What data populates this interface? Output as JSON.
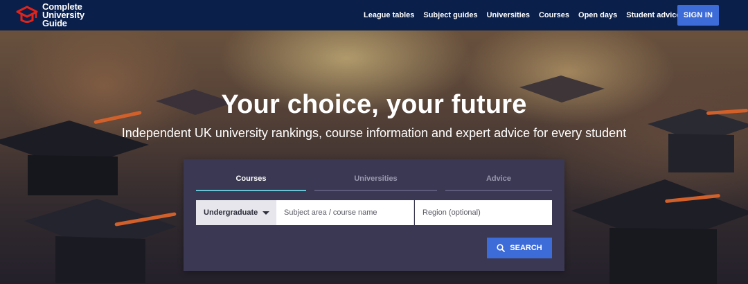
{
  "header": {
    "logo_lines": [
      "Complete",
      "University",
      "Guide"
    ],
    "nav": [
      {
        "label": "League tables"
      },
      {
        "label": "Subject guides"
      },
      {
        "label": "Universities"
      },
      {
        "label": "Courses"
      },
      {
        "label": "Open days"
      },
      {
        "label": "Student advice"
      }
    ],
    "signin_label": "SIGN IN",
    "colors": {
      "bar": "#0a1f4a",
      "accent": "#3d6bd8",
      "logo_red": "#e2231a"
    }
  },
  "hero": {
    "title": "Your choice, your future",
    "subtitle": "Independent UK university rankings, course information and expert advice for every student"
  },
  "search": {
    "tabs": [
      {
        "label": "Courses",
        "active": true
      },
      {
        "label": "Universities",
        "active": false
      },
      {
        "label": "Advice",
        "active": false
      }
    ],
    "level": {
      "value": "Undergraduate",
      "icon": "chevron-down-icon"
    },
    "subject_placeholder": "Subject area / course name",
    "region_placeholder": "Region (optional)",
    "button_label": "SEARCH",
    "button_icon": "search-icon"
  }
}
